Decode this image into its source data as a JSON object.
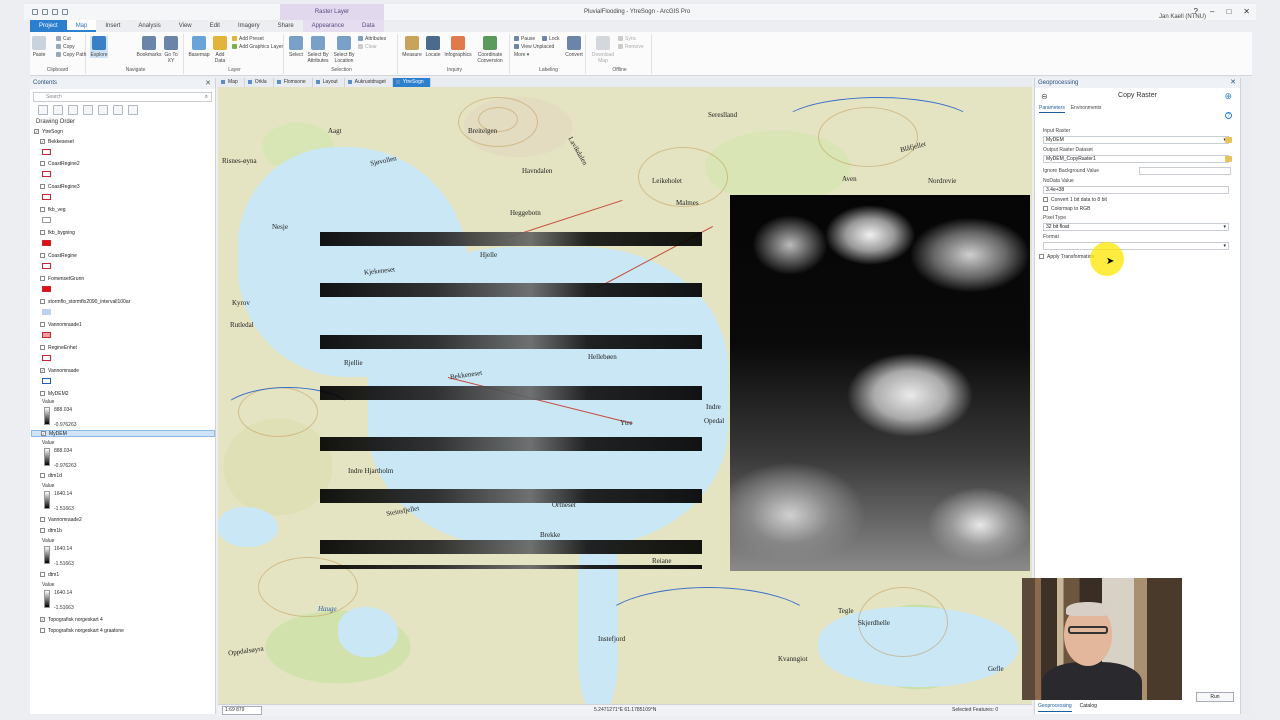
{
  "window": {
    "title": "PluvialFlooding - YtreSogn - ArcGIS Pro",
    "context_group": "Raster Layer",
    "user": "Jan Kaell (NTNU)"
  },
  "ribbon_tabs": [
    "Project",
    "Map",
    "Insert",
    "Analysis",
    "View",
    "Edit",
    "Imagery",
    "Share",
    "Appearance",
    "Data"
  ],
  "ribbon": {
    "clipboard": {
      "label": "Clipboard",
      "paste": "Paste",
      "cut": "Cut",
      "copy": "Copy",
      "copy_path": "Copy Path"
    },
    "navigate": {
      "label": "Navigate",
      "explore": "Explore",
      "bookmarks": "Bookmarks",
      "go_to_xy": "Go To XY"
    },
    "layer": {
      "label": "Layer",
      "basemap": "Basemap",
      "add_data": "Add Data",
      "add_preset": "Add Preset",
      "add_graphics_layer": "Add Graphics Layer"
    },
    "selection": {
      "label": "Selection",
      "select": "Select",
      "select_by_attributes": "Select By Attributes",
      "select_by_location": "Select By Location",
      "attributes": "Attributes",
      "clear": "Clear"
    },
    "inquiry": {
      "label": "Inquiry",
      "measure": "Measure",
      "locate": "Locate",
      "infographics": "Infographics",
      "coordinate_conversion": "Coordinate Conversion"
    },
    "labeling": {
      "label": "Labeling",
      "pause": "Pause",
      "lock": "Lock",
      "view_unplaced": "View Unplaced",
      "more": "More",
      "convert": "Convert"
    },
    "offline": {
      "label": "Offline",
      "download_map": "Download Map",
      "sync": "Sync",
      "remove": "Remove"
    }
  },
  "contents": {
    "title": "Contents",
    "search_placeholder": "Search",
    "drawing_order": "Drawing Order",
    "map_name": "YtreSogn",
    "layers": [
      {
        "name": "Bekkeseset",
        "checked": true
      },
      {
        "name": "CoastRegine2",
        "checked": false
      },
      {
        "name": "CoastRegine3",
        "checked": false
      },
      {
        "name": "fkb_veg",
        "checked": false
      },
      {
        "name": "fkb_bygning",
        "checked": false
      },
      {
        "name": "CoastRegine",
        "checked": false
      },
      {
        "name": "FomensetGrunn",
        "checked": false
      },
      {
        "name": "stormflo_stormflo2090_intervall100ar",
        "checked": false
      },
      {
        "name": "Vannomraade1",
        "checked": false
      },
      {
        "name": "RegineEnhet",
        "checked": false
      },
      {
        "name": "Vannomraade",
        "checked": true
      },
      {
        "name": "MyDEM2",
        "checked": false
      },
      {
        "name": "MyDEM",
        "checked": true,
        "selected": true
      },
      {
        "name": "dtm1d",
        "checked": false
      },
      {
        "name": "Vannomraade2",
        "checked": false
      },
      {
        "name": "dtm1b",
        "checked": false
      },
      {
        "name": "dtm1",
        "checked": false
      },
      {
        "name": "Topografisk norgeskart 4",
        "checked": true
      },
      {
        "name": "Topografisk norgeskart 4 graatone",
        "checked": false
      }
    ],
    "legend": {
      "value_label": "Value",
      "mydem2": [
        "888.034",
        "-0.976263"
      ],
      "mydem": [
        "888.034",
        "-0.976263"
      ],
      "dtm1d": [
        "1640.14",
        "-1.51663"
      ],
      "dtm1b": [
        "1640.14",
        "-1.51663"
      ],
      "dtm1": [
        "1640.14",
        "-1.51663"
      ]
    }
  },
  "view_tabs": [
    "Map",
    "Orkla",
    "Flomsone",
    "Layout",
    "Aukrustdraget",
    "YtreSogn"
  ],
  "map": {
    "labels": [
      "Risnes-øyna",
      "Nesje",
      "Kjekeneset",
      "Kyrov",
      "Rutledal",
      "Bekkeneset",
      "Hellebøen",
      "Ytre",
      "Indre Hjartholm",
      "Indre",
      "Opedal",
      "Steinsfjellet",
      "Ortneset",
      "Brekke",
      "Oppdalsøyra",
      "Instefjord",
      "Sjøvollen",
      "Heggebotn",
      "Havndalen",
      "Leikeholet",
      "Lavikdalen",
      "Aven",
      "Blåfjellet",
      "Sereslland",
      "Nordrevie",
      "Breiteigen",
      "Aagt",
      "Tegle",
      "Skjerdhelle",
      "Kvanngiot",
      "Gefle",
      "Hauge",
      "Reiane",
      "Malmes",
      "Hjelle",
      "Rjellie"
    ]
  },
  "status": {
    "scale": "1:69 879",
    "coords": "5.2471271°E 61.1785109°N",
    "selected": "Selected Features: 0"
  },
  "geoprocessing": {
    "title": "Geoprocessing",
    "tool": "Copy Raster",
    "tabs": [
      "Parameters",
      "Environments"
    ],
    "input_raster_label": "Input Raster",
    "input_raster": "MyDEM",
    "output_label": "Output Raster Dataset",
    "output": "MyDEM_CopyRaster1",
    "ignore_bg_label": "Ignore Background Value",
    "nodata_label": "NoData Value",
    "nodata": "3.4e+38",
    "convert_1bit": "Convert 1 bit data to 8 bit",
    "colormap_rgb": "Colormap to RGB",
    "pixel_type_label": "Pixel Type",
    "pixel_type": "32 bit float",
    "format_label": "Format",
    "apply_transform": "Apply Transformation",
    "footer_tabs": [
      "Geoprocessing",
      "Catalog"
    ],
    "run": "Run"
  }
}
